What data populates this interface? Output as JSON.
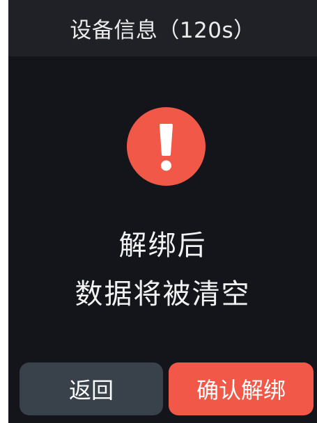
{
  "header": {
    "title": "设备信息（120s）"
  },
  "alert": {
    "icon": "exclamation-icon",
    "icon_color": "#f25848",
    "line1": "解绑后",
    "line2": "数据将被清空"
  },
  "actions": {
    "back_label": "返回",
    "back_color": "#39414a",
    "confirm_label": "确认解绑",
    "confirm_color": "#f25848"
  }
}
